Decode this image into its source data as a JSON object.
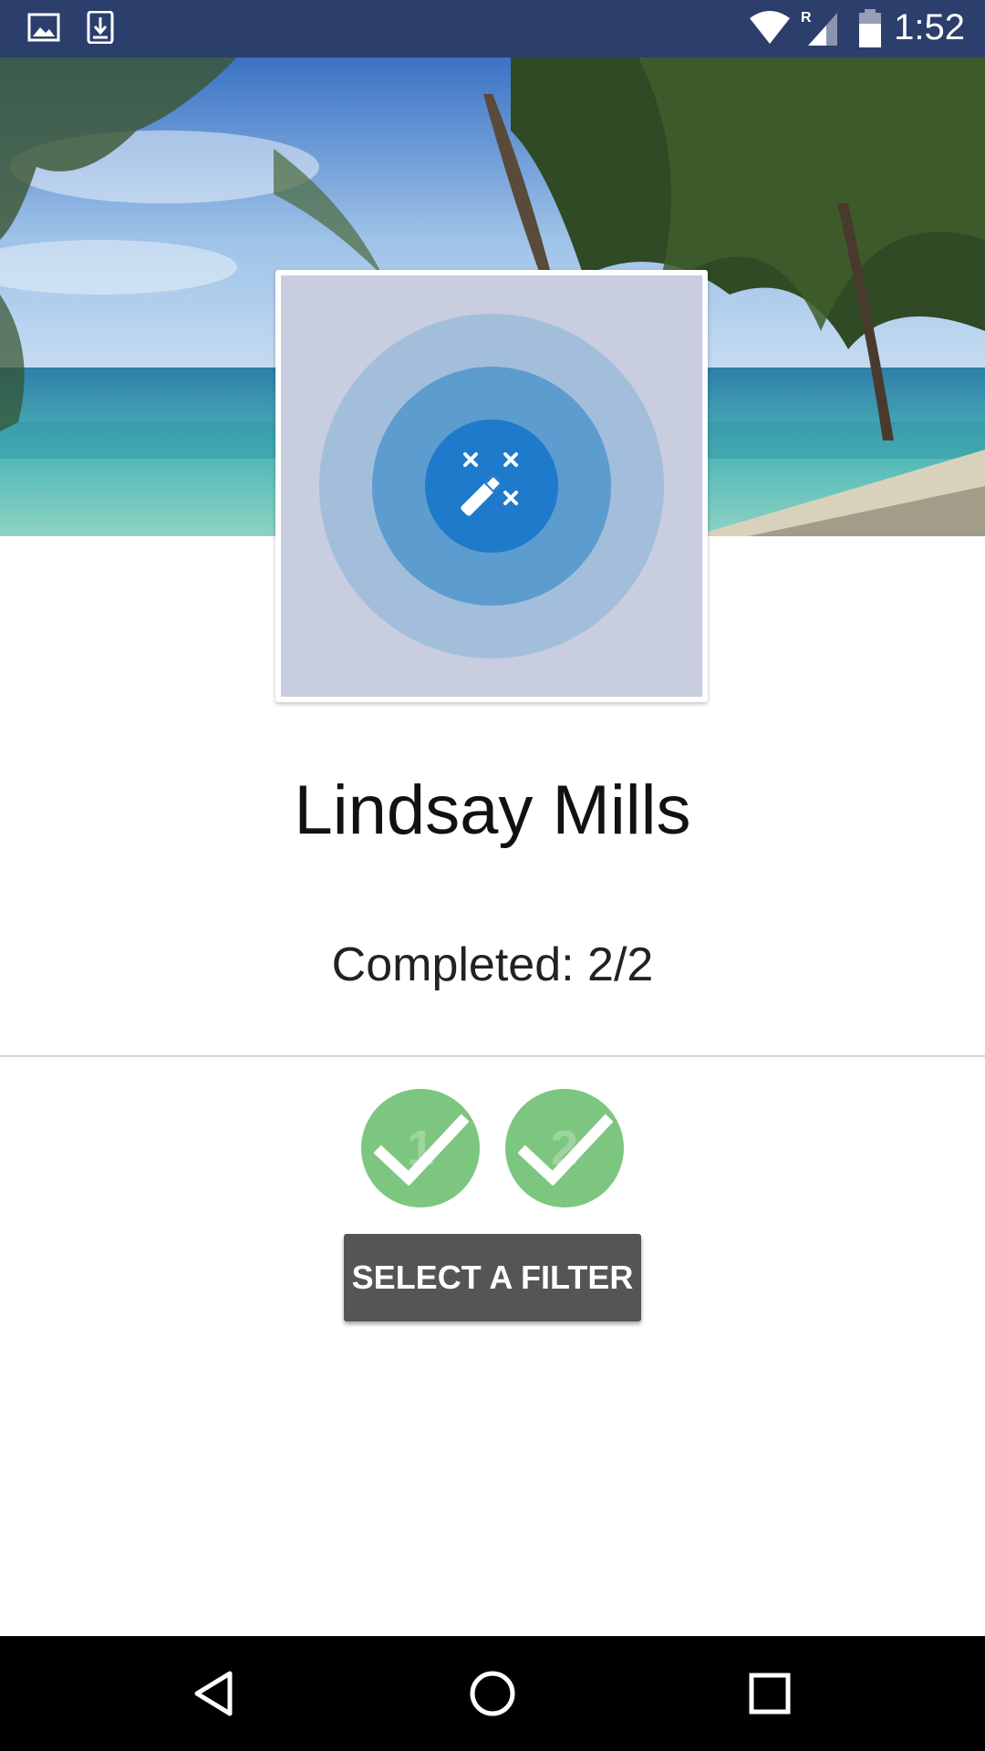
{
  "status_bar": {
    "time": "1:52",
    "icons": [
      "image-icon",
      "download-icon",
      "wifi-icon",
      "signal-roaming-icon",
      "battery-icon"
    ]
  },
  "profile": {
    "name": "Lindsay Mills",
    "completed_label": "Completed: 2/2",
    "avatar_icon": "magic-wand-icon"
  },
  "steps": [
    {
      "number": "1",
      "status": "completed"
    },
    {
      "number": "2",
      "status": "completed"
    }
  ],
  "actions": {
    "select_filter_label": "SELECT A FILTER"
  },
  "nav_bar": {
    "icons": [
      "back-icon",
      "home-icon",
      "recents-icon"
    ]
  },
  "colors": {
    "status_bar": "#2c3e6b",
    "step_complete": "#7dc67f",
    "button": "#555555",
    "avatar_ring_inner": "#1f7acb"
  }
}
